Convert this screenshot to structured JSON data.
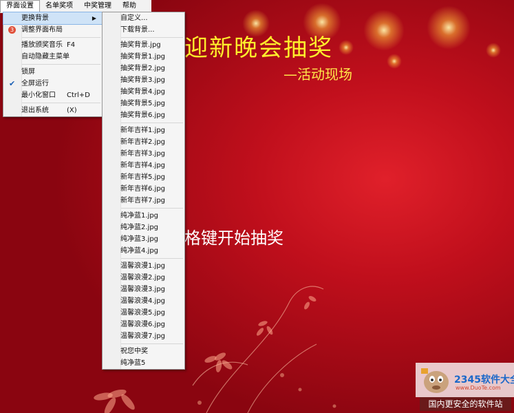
{
  "menubar": {
    "items": [
      "界面设置",
      "名单奖项",
      "中奖管理",
      "帮助"
    ]
  },
  "main_menu": {
    "items": [
      {
        "label": "更换背景",
        "type": "submenu",
        "highlighted": true
      },
      {
        "label": "调整界面布局",
        "badge": "3"
      },
      {
        "type": "separator"
      },
      {
        "label": "播放颁奖音乐",
        "shortcut": "F4"
      },
      {
        "label": "自动隐藏主菜单"
      },
      {
        "type": "separator"
      },
      {
        "label": "锁屏"
      },
      {
        "label": "全屏运行",
        "checked": true
      },
      {
        "label": "最小化窗口",
        "shortcut": "Ctrl+D"
      },
      {
        "type": "separator"
      },
      {
        "label": "退出系统",
        "shortcut": "(X)"
      }
    ]
  },
  "background_submenu": {
    "items": [
      {
        "label": "自定义..."
      },
      {
        "label": "下载背景..."
      },
      {
        "type": "separator"
      },
      {
        "label": "抽奖背景.jpg"
      },
      {
        "label": "抽奖背景1.jpg"
      },
      {
        "label": "抽奖背景2.jpg"
      },
      {
        "label": "抽奖背景3.jpg"
      },
      {
        "label": "抽奖背景4.jpg"
      },
      {
        "label": "抽奖背景5.jpg"
      },
      {
        "label": "抽奖背景6.jpg"
      },
      {
        "type": "separator"
      },
      {
        "label": "新年吉祥1.jpg"
      },
      {
        "label": "新年吉祥2.jpg"
      },
      {
        "label": "新年吉祥3.jpg"
      },
      {
        "label": "新年吉祥4.jpg"
      },
      {
        "label": "新年吉祥5.jpg"
      },
      {
        "label": "新年吉祥6.jpg"
      },
      {
        "label": "新年吉祥7.jpg"
      },
      {
        "type": "separator"
      },
      {
        "label": "纯净蓝1.jpg"
      },
      {
        "label": "纯净蓝2.jpg"
      },
      {
        "label": "纯净蓝3.jpg"
      },
      {
        "label": "纯净蓝4.jpg"
      },
      {
        "type": "separator"
      },
      {
        "label": "温馨浪漫1.jpg"
      },
      {
        "label": "温馨浪漫2.jpg"
      },
      {
        "label": "温馨浪漫3.jpg"
      },
      {
        "label": "温馨浪漫4.jpg"
      },
      {
        "label": "温馨浪漫5.jpg"
      },
      {
        "label": "温馨浪漫6.jpg"
      },
      {
        "label": "温馨浪漫7.jpg"
      },
      {
        "type": "separator"
      },
      {
        "label": "祝您中奖"
      },
      {
        "label": "纯净蓝5"
      }
    ]
  },
  "stage": {
    "title": "迎新晚会抽奖",
    "subtitle": "—活动现场",
    "hint": "格键开始抽奖"
  },
  "watermark": {
    "logo": "2345软件大全",
    "url": "www.DuoTe.com",
    "tagline": "国内更安全的软件站"
  },
  "colors": {
    "background": "#c00f1c",
    "title": "#ffef2c",
    "hint": "#ffffff",
    "menu_highlight": "#cfe3f7"
  }
}
